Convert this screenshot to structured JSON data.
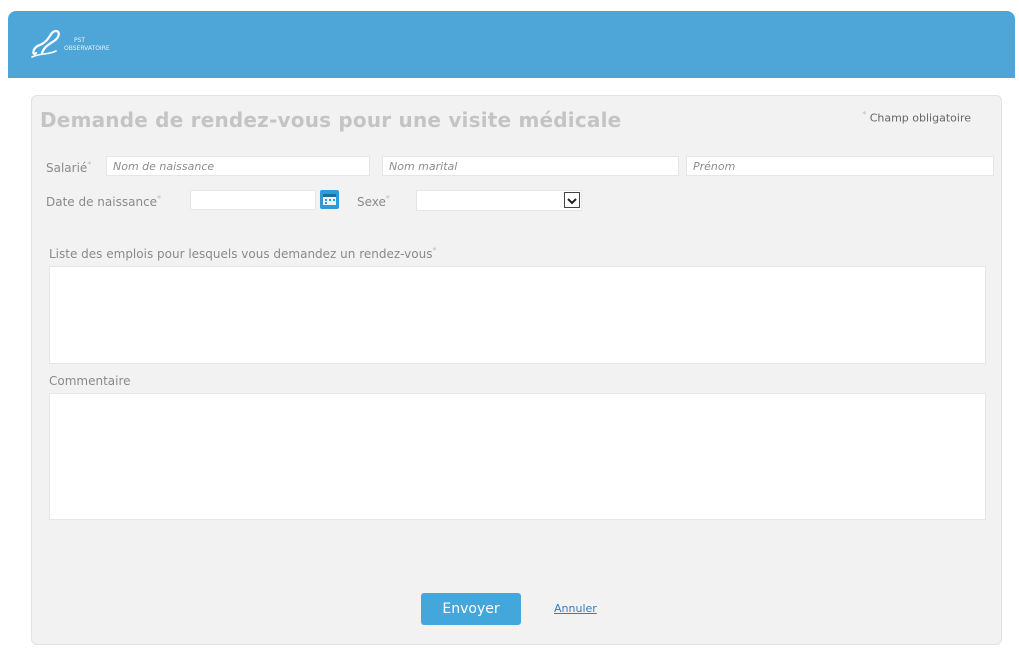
{
  "header": {
    "logo_line1": "PST",
    "logo_line2": "OBSERVATOIRE",
    "colors": {
      "bar": "#4ea6d8"
    }
  },
  "form": {
    "title": "Demande de rendez-vous pour une visite médicale",
    "required_note": "Champ obligatoire",
    "required_marker": "*",
    "salarie_label": "Salarié",
    "nom_naissance_placeholder": "Nom de naissance",
    "nom_marital_placeholder": "Nom marital",
    "prenom_placeholder": "Prénom",
    "date_naissance_label": "Date de naissance",
    "sexe_label": "Sexe",
    "sexe_value": "",
    "emplois_label": "Liste des emplois pour lesquels vous demandez un rendez-vous",
    "commentaire_label": "Commentaire",
    "send_button": "Envoyer",
    "cancel_link": "Annuler"
  },
  "icons": {
    "calendar": "calendar-icon",
    "select_arrow": "chevron-down-icon"
  }
}
